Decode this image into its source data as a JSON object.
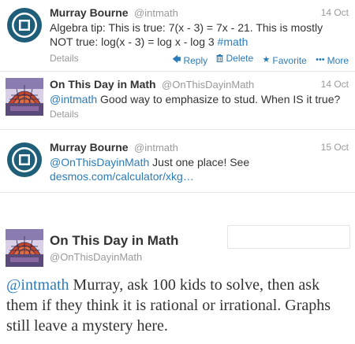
{
  "colors": {
    "link": "#2b7bb9",
    "muted": "#999999",
    "text": "#333333",
    "avatar_ring": "#1f5e78"
  },
  "tweets": [
    {
      "name": "Murray Bourne",
      "handle": "@intmath",
      "time": "14 Oct",
      "avatar": "intmath-logo",
      "text_plain": "Algebra tip: This is true: 7(x - 3) = 7x - 21. This is mostly NOT true: log(x - 3) = log x - log 3 ",
      "hashtag": "#math",
      "details": "Details",
      "actions": {
        "reply": "Reply",
        "delete": "Delete",
        "favorite": "Favorite",
        "more": "More"
      }
    },
    {
      "name": "On This Day in Math",
      "handle": "@OnThisDayinMath",
      "time": "14 Oct",
      "avatar": "polyhedron-dome",
      "mention": "@intmath",
      "text_plain": " Good way to emphasize to stud.  When IS it true?",
      "details": "Details"
    },
    {
      "name": "Murray Bourne",
      "handle": "@intmath",
      "time": "15 Oct",
      "avatar": "intmath-logo",
      "mention": "@OnThisDayinMath",
      "text_plain": "  Just one place! See ",
      "link": "desmos.com/calculator/xkg…",
      "details": "Details"
    }
  ],
  "expanded": {
    "name": "On This Day in Math",
    "handle": "@OnThisDayinMath",
    "avatar": "polyhedron-dome",
    "mention": "@intmath",
    "text_plain": " Murray, ask 100 kids to solve, then ask them if they think it is rational or irrational. Graphs still leave a mystery here."
  }
}
